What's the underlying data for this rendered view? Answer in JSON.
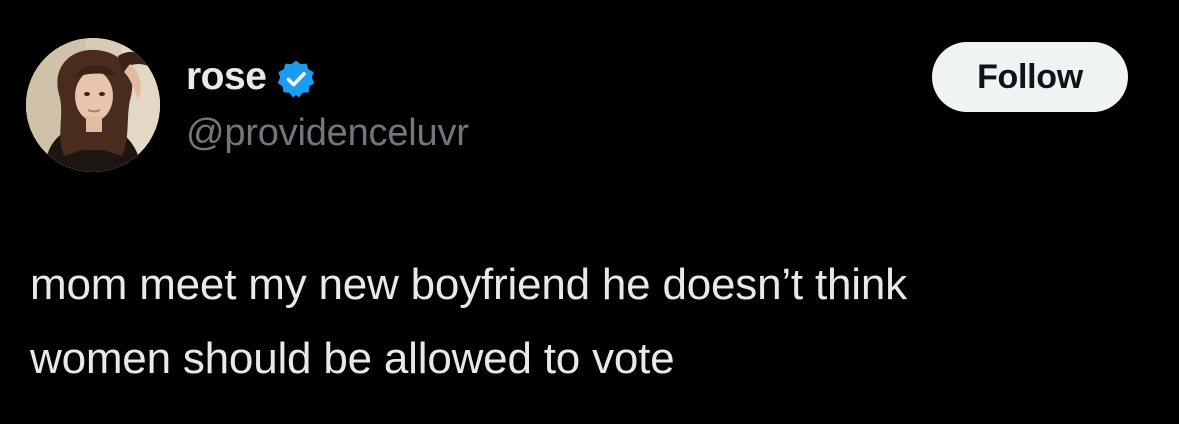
{
  "tweet": {
    "author": {
      "display_name": "rose",
      "handle": "@providenceluvr",
      "verified": true
    },
    "follow_label": "Follow",
    "text_lines": [
      "mom meet my new boyfriend he doesn’t think",
      "women should be allowed to vote"
    ]
  },
  "icons": {
    "avatar": "profile-photo",
    "verified": "verified-badge-icon"
  },
  "colors": {
    "background": "#000000",
    "primary_text": "#e7e9ea",
    "secondary_text": "#71767b",
    "verified_blue": "#1d9bf0",
    "follow_button_bg": "#eff3f4",
    "follow_button_text": "#0f1419"
  }
}
